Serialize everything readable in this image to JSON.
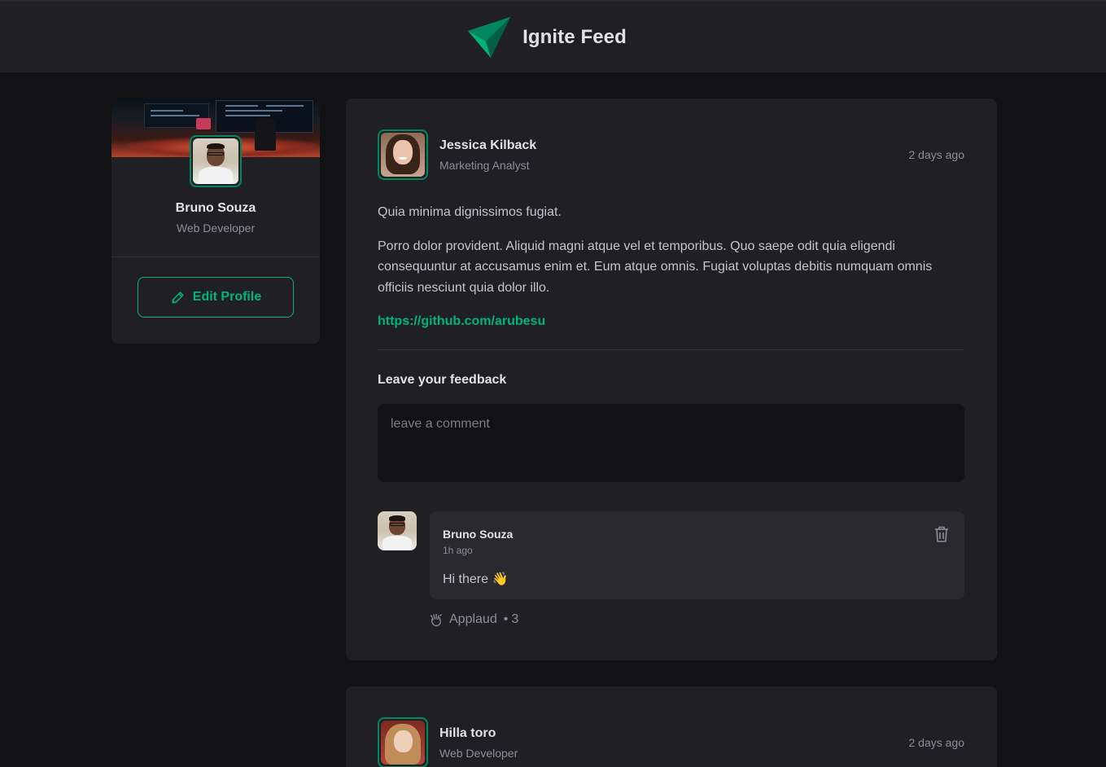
{
  "header": {
    "title": "Ignite Feed",
    "logo_icon": "ignite-logo-icon"
  },
  "sidebar": {
    "name": "Bruno Souza",
    "role": "Web Developer",
    "edit_label": "Edit Profile"
  },
  "posts": [
    {
      "author": {
        "name": "Jessica Kilback",
        "role": "Marketing Analyst"
      },
      "time": "2 days ago",
      "paragraphs": [
        "Quia minima dignissimos fugiat.",
        "Porro dolor provident. Aliquid magni atque vel et temporibus. Quo saepe odit quia eligendi consequuntur at accusamus enim et. Eum atque omnis. Fugiat voluptas debitis numquam omnis officiis nesciunt quia dolor illo."
      ],
      "link": "https://github.com/arubesu",
      "feedback_title": "Leave your feedback",
      "comment_placeholder": "leave a comment",
      "comments": [
        {
          "author": "Bruno Souza",
          "time": "1h ago",
          "text": "Hi there 👋",
          "applaud_label": "Applaud",
          "applaud_separator": "•",
          "applaud_count": "3"
        }
      ]
    },
    {
      "author": {
        "name": "Hilla toro",
        "role": "Web Developer"
      },
      "time": "2 days ago"
    }
  ],
  "colors": {
    "accent": "#00b37e",
    "accent_dark": "#00875f",
    "background": "#121214",
    "surface": "#202024"
  }
}
